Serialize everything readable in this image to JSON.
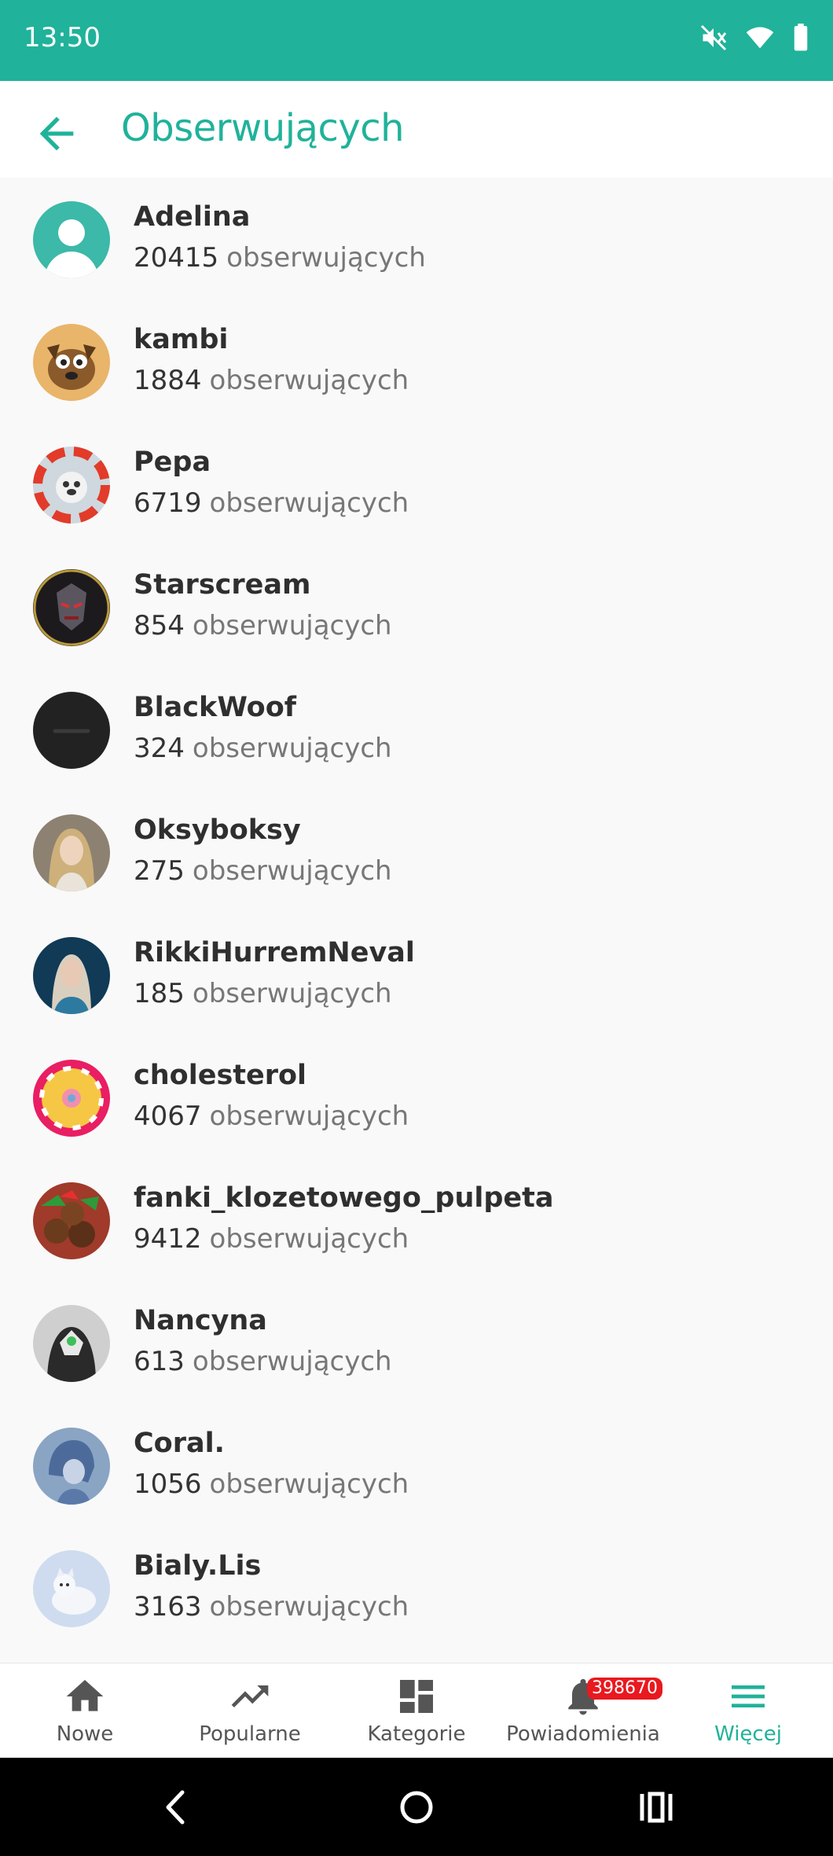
{
  "status_bar": {
    "time": "13:50",
    "icons": [
      "mute-icon",
      "wifi-icon",
      "battery-icon"
    ],
    "background": "#20b29a"
  },
  "app_bar": {
    "title": "Obserwujących",
    "back_icon": "arrow-back-icon"
  },
  "followers": [
    {
      "name": "Adelina",
      "count": "20415",
      "suffix": "obserwujących"
    },
    {
      "name": "kambi",
      "count": "1884",
      "suffix": "obserwujących"
    },
    {
      "name": "Pepa",
      "count": "6719",
      "suffix": "obserwujących"
    },
    {
      "name": "Starscream",
      "count": "854",
      "suffix": "obserwujących"
    },
    {
      "name": "BlackWoof",
      "count": "324",
      "suffix": "obserwujących"
    },
    {
      "name": "Oksyboksy",
      "count": "275",
      "suffix": "obserwujących"
    },
    {
      "name": "RikkiHurremNeval",
      "count": "185",
      "suffix": "obserwujących"
    },
    {
      "name": "cholesterol",
      "count": "4067",
      "suffix": "obserwujących"
    },
    {
      "name": "fanki_klozetowego_pulpeta",
      "count": "9412",
      "suffix": "obserwujących"
    },
    {
      "name": "Nancyna",
      "count": "613",
      "suffix": "obserwujących"
    },
    {
      "name": "Coral.",
      "count": "1056",
      "suffix": "obserwujących"
    },
    {
      "name": "Bialy.Lis",
      "count": "3163",
      "suffix": "obserwujących"
    }
  ],
  "bottom_nav": {
    "items": [
      {
        "label": "Nowe",
        "icon": "home-icon"
      },
      {
        "label": "Popularne",
        "icon": "trending-icon"
      },
      {
        "label": "Kategorie",
        "icon": "dashboard-icon"
      },
      {
        "label": "Powiadomienia",
        "icon": "bell-icon",
        "badge": "398670"
      },
      {
        "label": "Więcej",
        "icon": "menu-icon"
      }
    ],
    "active": "Więcej",
    "accent": "#20b29a",
    "badge_color": "#e8191f"
  },
  "system_nav": {
    "icons": [
      "system-back-icon",
      "system-home-icon",
      "system-recents-icon"
    ]
  }
}
